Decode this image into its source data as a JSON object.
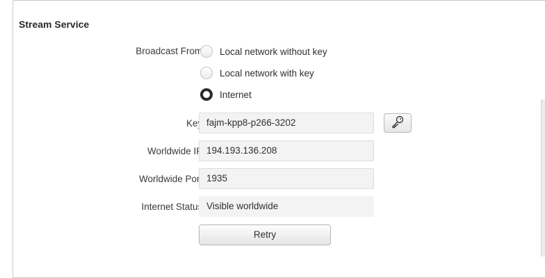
{
  "section": {
    "title": "Stream Service"
  },
  "broadcast_from": {
    "label": "Broadcast From:",
    "options": [
      {
        "label": "Local network without key",
        "selected": false
      },
      {
        "label": "Local network with key",
        "selected": false
      },
      {
        "label": "Internet",
        "selected": true
      }
    ]
  },
  "key": {
    "label": "Key:",
    "value": "fajm-kpp8-p266-3202",
    "button_icon": "key-icon"
  },
  "worldwide_ip": {
    "label": "Worldwide IP:",
    "value": "194.193.136.208"
  },
  "worldwide_port": {
    "label": "Worldwide Port:",
    "value": "1935"
  },
  "internet_status": {
    "label": "Internet Status:",
    "value": "Visible worldwide"
  },
  "retry_button": {
    "label": "Retry"
  }
}
